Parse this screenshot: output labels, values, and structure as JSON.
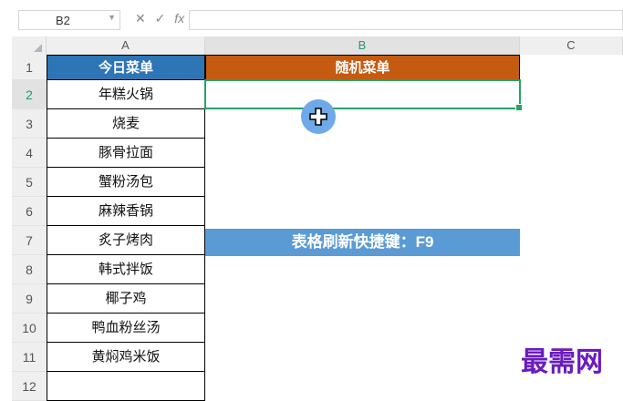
{
  "formula_bar": {
    "cell_ref": "B2",
    "icons": [
      "chevron-down-icon",
      "cancel-icon",
      "confirm-icon",
      "fx-icon"
    ],
    "cancel_glyph": "✕",
    "confirm_glyph": "✓",
    "fx_glyph": "fx",
    "formula_value": ""
  },
  "columns": [
    "A",
    "B",
    "C"
  ],
  "rows": [
    "1",
    "2",
    "3",
    "4",
    "5",
    "6",
    "7",
    "8",
    "9",
    "10",
    "11",
    "12"
  ],
  "sheet": {
    "header_a": "今日菜单",
    "header_b": "随机菜单",
    "menu_items": [
      "年糕火锅",
      "烧麦",
      "豚骨拉面",
      "蟹粉汤包",
      "麻辣香锅",
      "炙子烤肉",
      "韩式拌饭",
      "椰子鸡",
      "鸭血粉丝汤",
      "黄焖鸡米饭"
    ],
    "banner": "表格刷新快捷键：F9",
    "selected_cell": "B2",
    "colors": {
      "header_a": "#2e75b6",
      "header_b": "#c55a11",
      "banner": "#5b9bd5",
      "selection": "#22a565"
    }
  },
  "watermark": "最需网"
}
